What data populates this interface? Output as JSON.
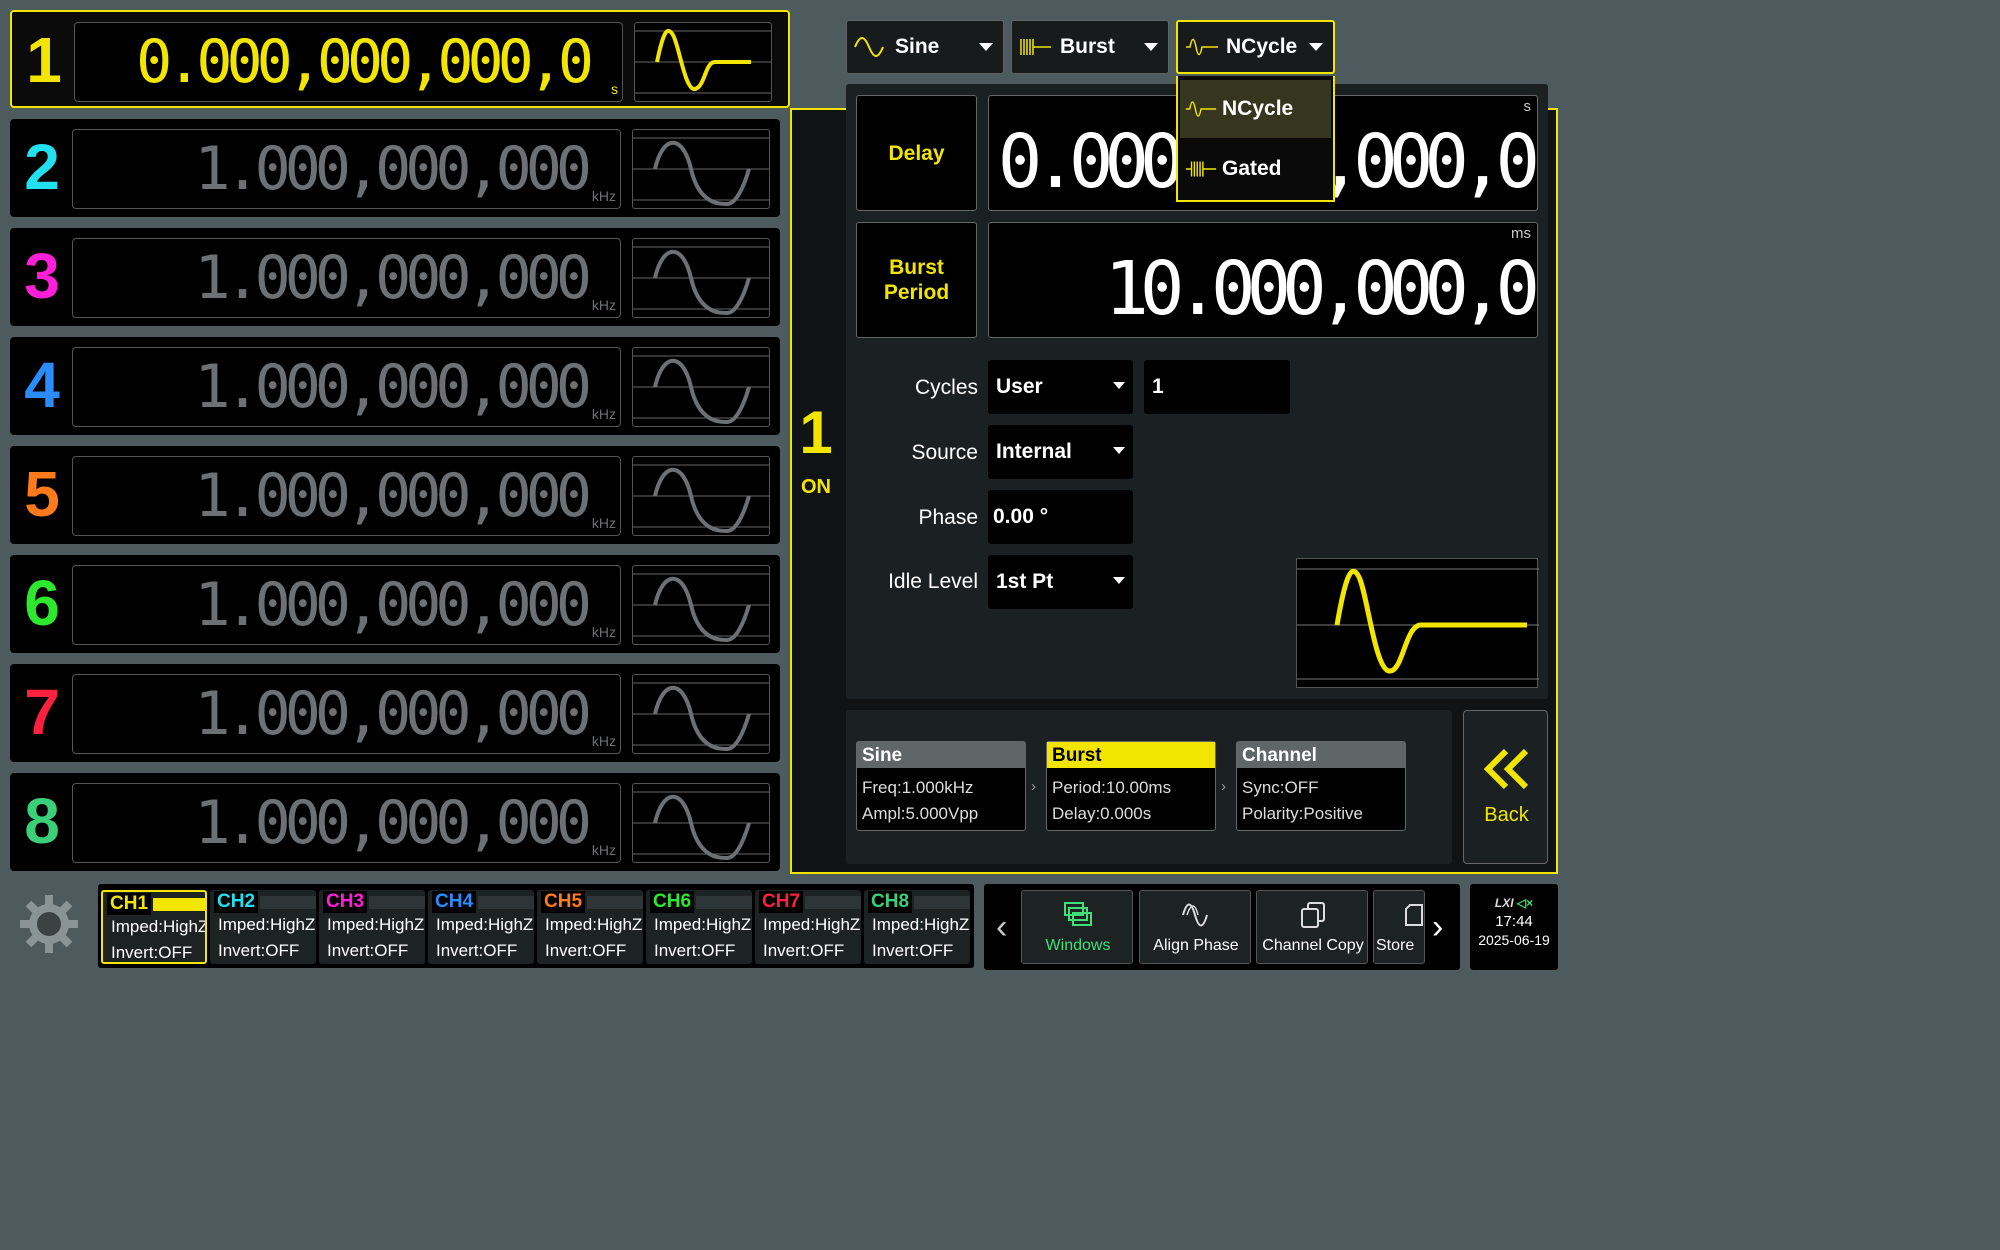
{
  "channels": [
    {
      "num": "1",
      "value": "0.000,000,000,0",
      "unit": "s",
      "color": "#f2e600",
      "active": true
    },
    {
      "num": "2",
      "value": "1.000,000,000",
      "unit": "kHz",
      "color": "#22e0f0"
    },
    {
      "num": "3",
      "value": "1.000,000,000",
      "unit": "kHz",
      "color": "#ff1fd6"
    },
    {
      "num": "4",
      "value": "1.000,000,000",
      "unit": "kHz",
      "color": "#2a8cff"
    },
    {
      "num": "5",
      "value": "1.000,000,000",
      "unit": "kHz",
      "color": "#ff7a1a"
    },
    {
      "num": "6",
      "value": "1.000,000,000",
      "unit": "kHz",
      "color": "#2ee82e"
    },
    {
      "num": "7",
      "value": "1.000,000,000",
      "unit": "kHz",
      "color": "#ff2040"
    },
    {
      "num": "8",
      "value": "1.000,000,000",
      "unit": "kHz",
      "color": "#3ccf7a"
    }
  ],
  "panel": {
    "channel_num": "1",
    "state": "ON",
    "waveform_dropdown": "Sine",
    "mode_dropdown": "Burst",
    "burst_type_dropdown": "NCycle",
    "burst_type_menu": [
      "NCycle",
      "Gated"
    ],
    "delay_label": "Delay",
    "delay_value": "0.000,000,000,0",
    "delay_unit": "s",
    "burst_period_label": "Burst Period",
    "burst_period_value": "10.000,000,0",
    "burst_period_unit": "ms",
    "cycles_label": "Cycles",
    "cycles_mode": "User",
    "cycles_value": "1",
    "source_label": "Source",
    "source_value": "Internal",
    "phase_label": "Phase",
    "phase_value": "0.00 °",
    "idle_label": "Idle Level",
    "idle_value": "1st Pt"
  },
  "summary": [
    {
      "title": "Sine",
      "line1": "Freq:1.000kHz",
      "line2": "Ampl:5.000Vpp",
      "active": false
    },
    {
      "title": "Burst",
      "line1": "Period:10.00ms",
      "line2": "Delay:0.000s",
      "active": true
    },
    {
      "title": "Channel",
      "line1": "Sync:OFF",
      "line2": "Polarity:Positive",
      "active": false
    }
  ],
  "back_label": "Back",
  "ch_tabs": [
    {
      "label": "CH1",
      "imped": "Imped:HighZ",
      "invert": "Invert:OFF",
      "color": "#f2e600",
      "active": true
    },
    {
      "label": "CH2",
      "imped": "Imped:HighZ",
      "invert": "Invert:OFF",
      "color": "#22e0f0"
    },
    {
      "label": "CH3",
      "imped": "Imped:HighZ",
      "invert": "Invert:OFF",
      "color": "#ff1fd6"
    },
    {
      "label": "CH4",
      "imped": "Imped:HighZ",
      "invert": "Invert:OFF",
      "color": "#2a8cff"
    },
    {
      "label": "CH5",
      "imped": "Imped:HighZ",
      "invert": "Invert:OFF",
      "color": "#ff7a1a"
    },
    {
      "label": "CH6",
      "imped": "Imped:HighZ",
      "invert": "Invert:OFF",
      "color": "#2ee82e"
    },
    {
      "label": "CH7",
      "imped": "Imped:HighZ",
      "invert": "Invert:OFF",
      "color": "#ff2040"
    },
    {
      "label": "CH8",
      "imped": "Imped:HighZ",
      "invert": "Invert:OFF",
      "color": "#3ccf7a"
    }
  ],
  "tools": [
    {
      "label": "Windows",
      "icon": "windows-icon",
      "highlight": true
    },
    {
      "label": "Align Phase",
      "icon": "align-phase-icon"
    },
    {
      "label": "Channel Copy",
      "icon": "channel-copy-icon"
    },
    {
      "label": "Store",
      "icon": "store-icon"
    }
  ],
  "status": {
    "lxi": "LXI",
    "time": "17:44",
    "date": "2025-06-19"
  },
  "colors": {
    "accent": "#f2e600",
    "highlight_green": "#3ee07a"
  }
}
